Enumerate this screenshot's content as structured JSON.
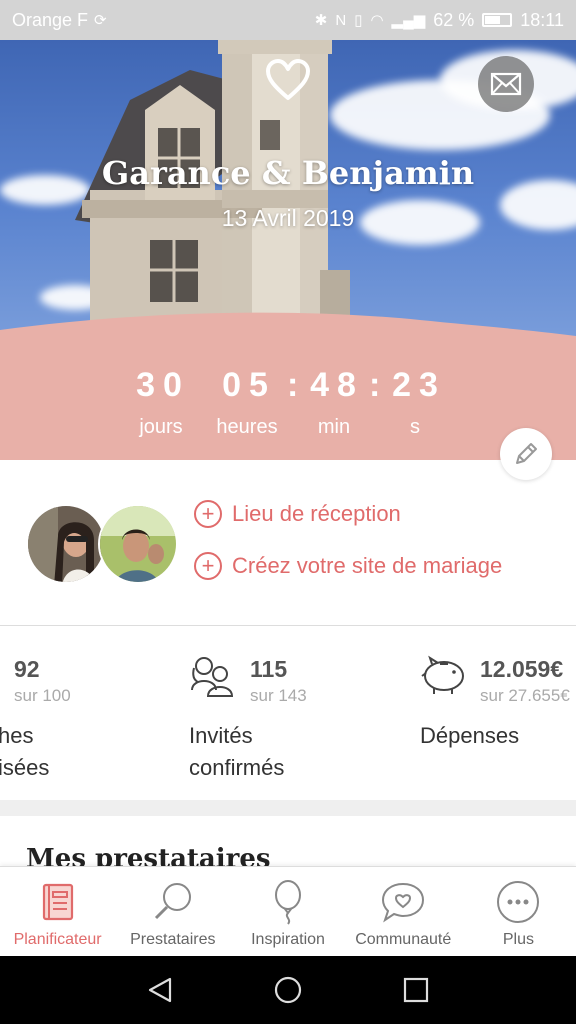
{
  "status_bar": {
    "carrier": "Orange F",
    "battery_text": "62 %",
    "time": "18:11",
    "battery_level": 0.62
  },
  "hero": {
    "couple_names": "Garance & Benjamin",
    "wedding_date": "13 Avril 2019",
    "icons": [
      "heart-icon",
      "mail-icon"
    ]
  },
  "countdown": {
    "days": "30",
    "hours": "05",
    "minutes": "48",
    "seconds": "23",
    "days_label": "jours",
    "hours_label": "heures",
    "minutes_label": "min",
    "seconds_label": "s"
  },
  "profile": {
    "links": [
      {
        "label": "Lieu de réception"
      },
      {
        "label": "Créez votre site de mariage"
      }
    ]
  },
  "stats": [
    {
      "value": "92",
      "sub": "sur 100",
      "label_line1": "hes",
      "label_line2": "isées"
    },
    {
      "value": "115",
      "sub": "sur 143",
      "label_line1": "Invités",
      "label_line2": "confirmés"
    },
    {
      "value": "12.059€",
      "sub": "sur 27.655€",
      "label_line1": "Dépenses",
      "label_line2": ""
    }
  ],
  "section_title": "Mes prestataires",
  "bottom_nav": [
    {
      "label": "Planificateur",
      "icon": "planner-icon",
      "active": true
    },
    {
      "label": "Prestataires",
      "icon": "search-icon",
      "active": false
    },
    {
      "label": "Inspiration",
      "icon": "balloon-icon",
      "active": false
    },
    {
      "label": "Communauté",
      "icon": "chat-heart-icon",
      "active": false
    },
    {
      "label": "Plus",
      "icon": "more-icon",
      "active": false
    }
  ],
  "colors": {
    "accent": "#e06b6b",
    "countdown_band": "#e8b0a8",
    "status_bar": "#d4d4d4"
  }
}
